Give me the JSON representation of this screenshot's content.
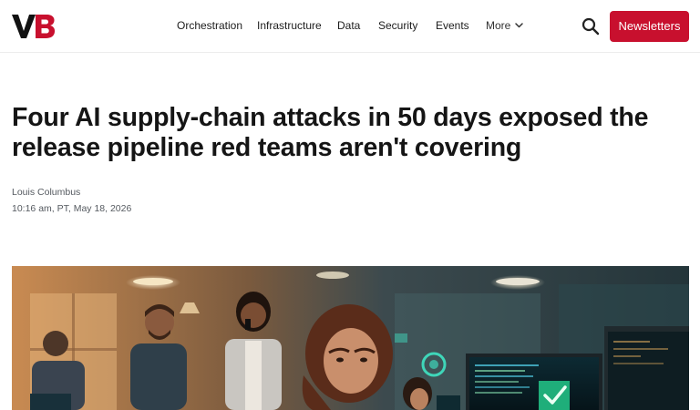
{
  "header": {
    "logo_text": "VB",
    "nav": [
      "Orchestration",
      "Infrastructure",
      "Data",
      "Security",
      "Events",
      "More"
    ],
    "search_icon": "search-icon",
    "newsletters_label": "Newsletters",
    "accent": "#c8102e"
  },
  "article": {
    "headline": "Four AI supply-chain attacks in 50 days exposed the release pipeline red teams aren't covering",
    "author": "Louis Columbus",
    "date": "10:16 am, PT, May 18, 2026"
  },
  "hero": {
    "image": "office-team-monitors-photo"
  }
}
